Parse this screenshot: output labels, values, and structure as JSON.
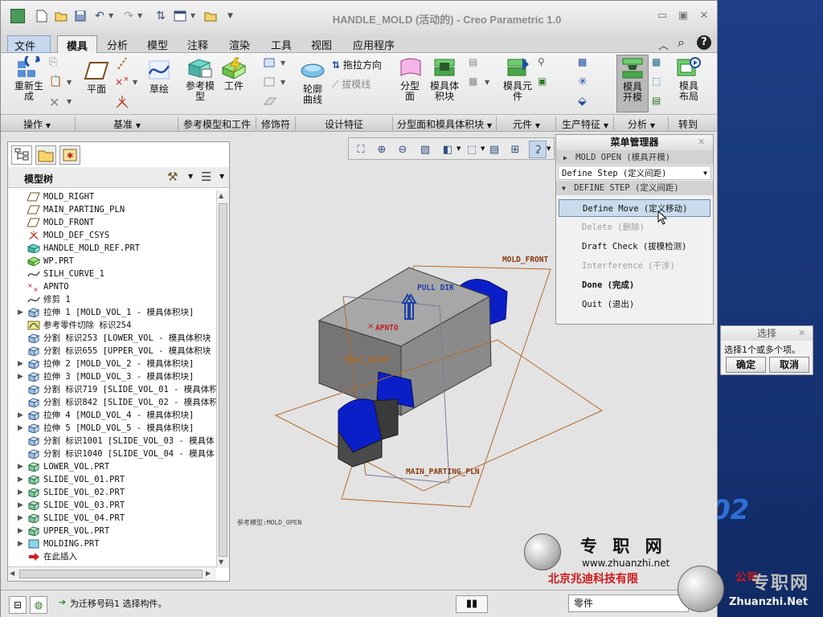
{
  "window": {
    "title": "HANDLE_MOLD (活动的) - Creo Parametric 1.0",
    "controls": [
      "minimize-icon",
      "maximize-icon",
      "close-icon"
    ]
  },
  "quick_access": [
    "app-icon",
    "new-icon",
    "open-icon",
    "save-icon",
    "undo-icon",
    "redo-icon",
    "regenerate-icon",
    "windows-icon",
    "folder-icon",
    "customize-icon"
  ],
  "tabs": [
    {
      "label": "文件",
      "kind": "file"
    },
    {
      "label": "模具",
      "kind": "active"
    },
    {
      "label": "分析"
    },
    {
      "label": "模型"
    },
    {
      "label": "注释"
    },
    {
      "label": "渲染"
    },
    {
      "label": "工具"
    },
    {
      "label": "视图"
    },
    {
      "label": "应用程序"
    }
  ],
  "ribbon": {
    "regenerate": "重新生\n成",
    "plane": "平面",
    "sketch": "草绘",
    "ref_model": "参考模\n型",
    "workpiece": "工件",
    "silhouette": "轮廓\n曲线",
    "pull_direction": "拖拉方向",
    "draft_line": "拔模线",
    "parting_surface": "分型\n面",
    "mold_volume": "模具体\n积块",
    "mold_component": "模具元\n件",
    "mold_open": "模具\n开模",
    "mold_layout": "模具\n布局"
  },
  "groups": [
    {
      "label": "操作",
      "dropdown": true
    },
    {
      "label": "基准",
      "dropdown": true
    },
    {
      "label": "参考模型和工件",
      "dropdown": false
    },
    {
      "label": "修饰符",
      "dropdown": false
    },
    {
      "label": "设计特征",
      "dropdown": false
    },
    {
      "label": "分型面和模具体积块",
      "dropdown": true
    },
    {
      "label": "元件",
      "dropdown": true
    },
    {
      "label": "生产特征",
      "dropdown": true
    },
    {
      "label": "分析",
      "dropdown": true
    },
    {
      "label": "转到",
      "dropdown": false
    }
  ],
  "model_tree": {
    "header": "模型树",
    "items": [
      {
        "label": "MOLD_RIGHT",
        "icon": "datum-plane-icon",
        "expand": false
      },
      {
        "label": "MAIN_PARTING_PLN",
        "icon": "datum-plane-icon",
        "expand": false
      },
      {
        "label": "MOLD_FRONT",
        "icon": "datum-plane-icon",
        "expand": false
      },
      {
        "label": "MOLD_DEF_CSYS",
        "icon": "csys-icon",
        "expand": false
      },
      {
        "label": "HANDLE_MOLD_REF.PRT",
        "icon": "ref-part-icon",
        "expand": false
      },
      {
        "label": "WP.PRT",
        "icon": "workpiece-icon",
        "expand": false
      },
      {
        "label": "SILH_CURVE_1",
        "icon": "curve-icon",
        "expand": false
      },
      {
        "label": "APNTO",
        "icon": "point-icon",
        "expand": false
      },
      {
        "label": "修剪 1",
        "icon": "curve-icon",
        "expand": false
      },
      {
        "label": "拉伸 1 [MOLD_VOL_1 - 模具体积块]",
        "icon": "extrude-icon",
        "expand": true
      },
      {
        "label": "参考零件切除 标识254",
        "icon": "cutout-icon",
        "expand": false
      },
      {
        "label": "分割 标识253 [LOWER_VOL - 模具体积块",
        "icon": "split-icon",
        "expand": false
      },
      {
        "label": "分割 标识655 [UPPER_VOL - 模具体积块",
        "icon": "split-icon",
        "expand": false
      },
      {
        "label": "拉伸 2 [MOLD_VOL_2 - 模具体积块]",
        "icon": "extrude-icon",
        "expand": true
      },
      {
        "label": "拉伸 3 [MOLD_VOL_3 - 模具体积块]",
        "icon": "extrude-icon",
        "expand": true
      },
      {
        "label": "分割 标识719 [SLIDE_VOL_01 - 模具体积",
        "icon": "split-icon",
        "expand": false
      },
      {
        "label": "分割 标识842 [SLIDE_VOL_02 - 模具体积",
        "icon": "split-icon",
        "expand": false
      },
      {
        "label": "拉伸 4 [MOLD_VOL_4 - 模具体积块]",
        "icon": "extrude-icon",
        "expand": true
      },
      {
        "label": "拉伸 5 [MOLD_VOL_5 - 模具体积块]",
        "icon": "extrude-icon",
        "expand": true
      },
      {
        "label": "分割 标识1001 [SLIDE_VOL_03 - 模具体",
        "icon": "split-icon",
        "expand": false
      },
      {
        "label": "分割 标识1040 [SLIDE_VOL_04 - 模具体",
        "icon": "split-icon",
        "expand": false
      },
      {
        "label": "LOWER_VOL.PRT",
        "icon": "part-icon",
        "expand": true
      },
      {
        "label": "SLIDE_VOL_01.PRT",
        "icon": "part-icon",
        "expand": true
      },
      {
        "label": "SLIDE_VOL_02.PRT",
        "icon": "part-icon",
        "expand": true
      },
      {
        "label": "SLIDE_VOL_03.PRT",
        "icon": "part-icon",
        "expand": true
      },
      {
        "label": "SLIDE_VOL_04.PRT",
        "icon": "part-icon",
        "expand": true
      },
      {
        "label": "UPPER_VOL.PRT",
        "icon": "part-icon",
        "expand": true
      },
      {
        "label": "MOLDING.PRT",
        "icon": "molding-icon",
        "expand": true
      },
      {
        "label": "在此插入",
        "icon": "insert-arrow-icon",
        "expand": false
      }
    ]
  },
  "canvas": {
    "labels": {
      "mold_front": "MOLD_FRONT",
      "pull_dir": "PULL DIR",
      "apnto": "APNTO",
      "mold_right": "MOLD_RIGHT",
      "main_parting": "MAIN_PARTING_PLN",
      "status_tag": "参考模型:MOLD_OPEN"
    }
  },
  "menu_manager": {
    "title": "菜单管理器",
    "mold_open": "MOLD OPEN (模具开模)",
    "define_step_select": "Define Step (定义间距)",
    "define_step_header": "DEFINE STEP (定义间距)",
    "items": [
      {
        "label": "Define Move (定义移动)",
        "state": "selected"
      },
      {
        "label": "Delete (删除)",
        "state": "disabled"
      },
      {
        "label": "Draft Check (拔模检测)",
        "state": "normal"
      },
      {
        "label": "Interference (干涉)",
        "state": "disabled"
      },
      {
        "label": "Done (完成)",
        "state": "bold"
      },
      {
        "label": "Quit (退出)",
        "state": "normal"
      }
    ]
  },
  "select_dialog": {
    "title": "选择",
    "prompt": "选择1个或多个项。",
    "ok": "确定",
    "cancel": "取消"
  },
  "statusbar": {
    "message": "为迁移号码1 选择构件。",
    "filter": "零件"
  },
  "watermark": {
    "cn_title": "专 职 网",
    "url": "www.zhuanzhi.net",
    "company": "北京兆迪科技有限",
    "company2": "公司",
    "brand2": "专职网",
    "url2": "Zhuanzhi.Net",
    "bg_text": "02"
  },
  "colors": {
    "accent_blue": "#1f3fa5",
    "mold_gray": "#8a8a8a",
    "slide_blue": "#0b1fc8",
    "plane_orange": "#b36a2a",
    "selected_row": "#c8dcec"
  }
}
